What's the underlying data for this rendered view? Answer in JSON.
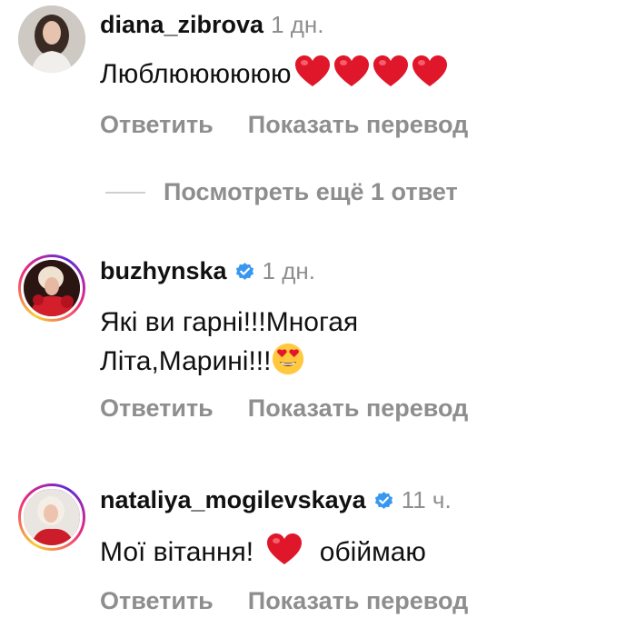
{
  "comments": [
    {
      "username": "diana_zibrova",
      "verified": false,
      "time": "1 дн.",
      "text": "Люблюююююю",
      "emoji": [
        "red-heart",
        "red-heart",
        "red-heart",
        "red-heart"
      ],
      "reply_label": "Ответить",
      "translate_label": "Показать перевод"
    },
    {
      "username": "buzhynska",
      "verified": true,
      "time": "1 дн.",
      "text_line1": "Які ви гарні!!!Многая",
      "text_line2": "Літа,Марині!!!",
      "emoji": [
        "heart-eyes"
      ],
      "reply_label": "Ответить",
      "translate_label": "Показать перевод"
    },
    {
      "username": "nataliya_mogilevskaya",
      "verified": true,
      "time": "11 ч.",
      "text_before": "Мої вітання!",
      "text_after": "обіймаю",
      "emoji": [
        "red-heart"
      ],
      "reply_label": "Ответить",
      "translate_label": "Показать перевод"
    }
  ],
  "view_more_replies": "Посмотреть ещё 1 ответ",
  "colors": {
    "text": "#111111",
    "secondary": "#8e8e8e",
    "heart": "#e0172b",
    "verified": "#3897f0"
  }
}
